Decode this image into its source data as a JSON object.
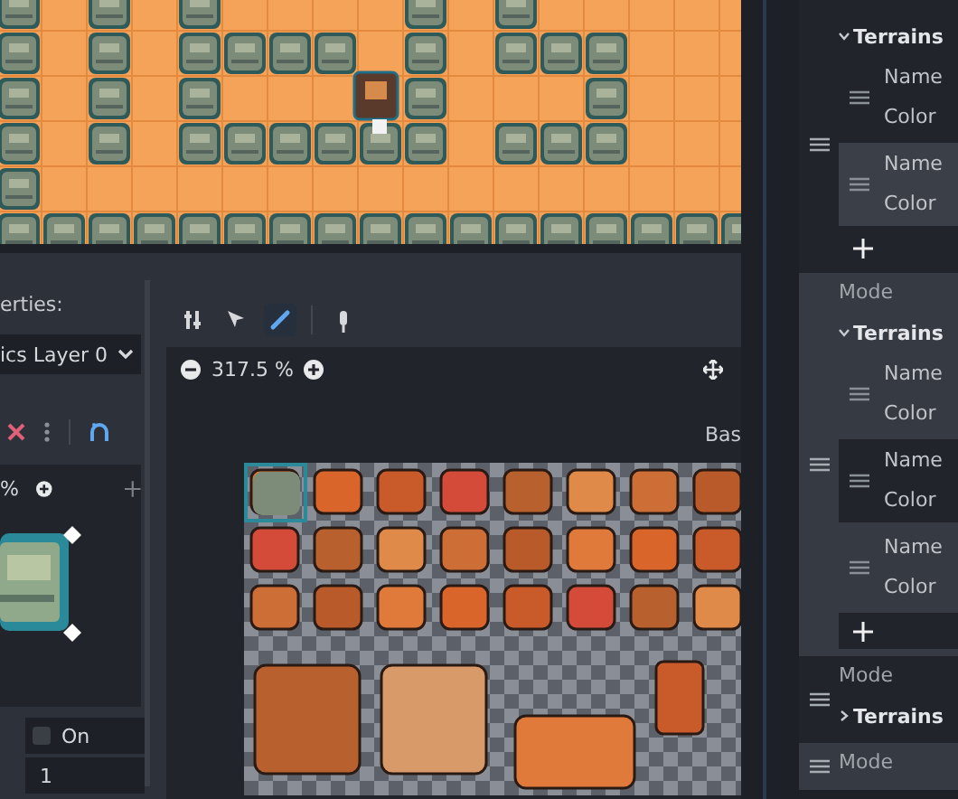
{
  "tile_properties": {
    "section_label": "erties:",
    "layer_dropdown": {
      "value": "ics Layer 0"
    },
    "zoom": {
      "value": "%"
    },
    "fields": [
      {
        "kind": "checkbox",
        "label": "On",
        "checked": false
      },
      {
        "kind": "number",
        "value": "1"
      }
    ]
  },
  "tile_editor": {
    "tools": [
      {
        "kind": "properties",
        "selected": false
      },
      {
        "kind": "select",
        "selected": false
      },
      {
        "kind": "paint",
        "selected": true
      },
      {
        "kind": "picker",
        "selected": false
      }
    ],
    "zoom": "317.5 %",
    "atlas_label": "Bas"
  },
  "terrain_sets": [
    {
      "terrains_label": "Terrains",
      "expanded": true,
      "terrains": [
        {
          "name_label": "Name",
          "color_label": "Color"
        },
        {
          "name_label": "Name",
          "color_label": "Color"
        }
      ]
    },
    {
      "mode_label": "Mode",
      "terrains_label": "Terrains",
      "expanded": true,
      "terrains": [
        {
          "name_label": "Name",
          "color_label": "Color"
        },
        {
          "name_label": "Name",
          "color_label": "Color"
        },
        {
          "name_label": "Name",
          "color_label": "Color"
        }
      ]
    },
    {
      "mode_label": "Mode",
      "terrains_label": "Terrains",
      "expanded": false
    },
    {
      "mode_label": "Mode"
    }
  ]
}
